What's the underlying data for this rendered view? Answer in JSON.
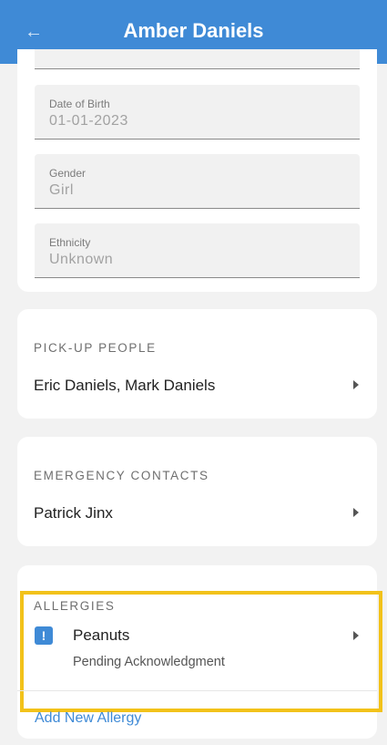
{
  "header": {
    "back_icon": "arrow-left-icon",
    "title": "Amber Daniels"
  },
  "profile": {
    "dob": {
      "label": "Date of Birth",
      "value": "01-01-2023"
    },
    "gender": {
      "label": "Gender",
      "value": "Girl"
    },
    "ethnicity": {
      "label": "Ethnicity",
      "value": "Unknown"
    }
  },
  "pickup": {
    "label": "PICK-UP PEOPLE",
    "value": "Eric Daniels, Mark  Daniels"
  },
  "emergency": {
    "label": "EMERGENCY CONTACTS",
    "value": "Patrick  Jinx"
  },
  "allergies": {
    "label": "ALLERGIES",
    "items": [
      {
        "badge": "!",
        "name": "Peanuts",
        "status": "Pending Acknowledgment"
      }
    ],
    "add_label": "Add New Allergy"
  },
  "colors": {
    "accent": "#3f8ad6",
    "highlight": "#f2c21a",
    "background": "#f2f2f2"
  }
}
